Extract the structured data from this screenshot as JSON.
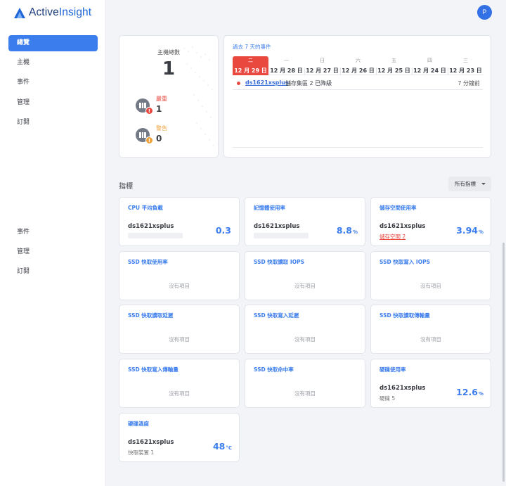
{
  "app": {
    "logo_a": "Active",
    "logo_b": "Insight"
  },
  "user": {
    "avatar_initial": "P"
  },
  "sidebar": {
    "items": [
      {
        "label": "總覽"
      },
      {
        "label": "主機"
      },
      {
        "label": "事件"
      },
      {
        "label": "管理"
      },
      {
        "label": "訂閱"
      }
    ],
    "lower_items": [
      {
        "label": "事件"
      },
      {
        "label": "管理"
      },
      {
        "label": "訂閱"
      }
    ]
  },
  "summary": {
    "host_label": "主機總數",
    "host_count": "1",
    "critical_label": "嚴重",
    "critical_count": "1",
    "warning_label": "警告",
    "warning_count": "0"
  },
  "events": {
    "title": "過去 7 天的事件",
    "days": [
      {
        "weekday": "二",
        "date": "12 月 29 日"
      },
      {
        "weekday": "一",
        "date": "12 月 28 日"
      },
      {
        "weekday": "日",
        "date": "12 月 27 日"
      },
      {
        "weekday": "六",
        "date": "12 月 26 日"
      },
      {
        "weekday": "五",
        "date": "12 月 25 日"
      },
      {
        "weekday": "四",
        "date": "12 月 24 日"
      },
      {
        "weekday": "三",
        "date": "12 月 23 日"
      }
    ],
    "rows": [
      {
        "host": "ds1621xsplus",
        "message": "儲存集區 2 已降級",
        "time": "7 分鐘前"
      }
    ]
  },
  "metrics_section": {
    "title": "指標",
    "filter_label": "所有指標"
  },
  "metrics": [
    {
      "title": "CPU 平均負載",
      "host": "ds1621xsplus",
      "value": "0.3",
      "unit": ""
    },
    {
      "title": "記憶體使用率",
      "host": "ds1621xsplus",
      "value": "8.8",
      "unit": "%"
    },
    {
      "title": "儲存空間使用率",
      "host": "ds1621xsplus",
      "value": "3.94",
      "unit": "%",
      "sub": "儲存空間 2"
    },
    {
      "title": "SSD 快取使用率",
      "empty": "沒有項目"
    },
    {
      "title": "SSD 快取讀取 IOPS",
      "empty": "沒有項目"
    },
    {
      "title": "SSD 快取寫入 IOPS",
      "empty": "沒有項目"
    },
    {
      "title": "SSD 快取讀取延遲",
      "empty": "沒有項目"
    },
    {
      "title": "SSD 快取寫入延遲",
      "empty": "沒有項目"
    },
    {
      "title": "SSD 快取讀取傳輸量",
      "empty": "沒有項目"
    },
    {
      "title": "SSD 快取寫入傳輸量",
      "empty": "沒有項目"
    },
    {
      "title": "SSD 快取命中率",
      "empty": "沒有項目"
    },
    {
      "title": "硬碟使用率",
      "host": "ds1621xsplus",
      "value": "12.6",
      "unit": "%",
      "sub": "硬碟 5"
    },
    {
      "title": "硬碟溫度",
      "host": "ds1621xsplus",
      "value": "48",
      "unit": "°C",
      "sub": "快取裝置 1"
    }
  ],
  "colors": {
    "accent": "#3b7ded",
    "critical": "#e9483f",
    "warning": "#f0a23a"
  }
}
